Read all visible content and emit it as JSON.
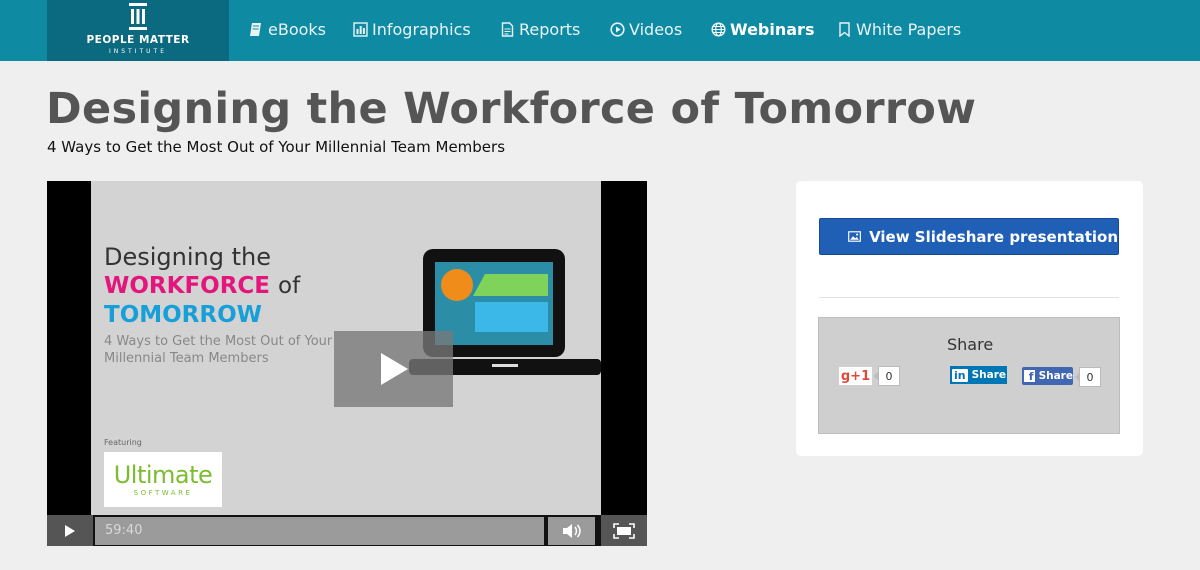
{
  "nav": {
    "logo_line1": "PEOPLE MATTER",
    "logo_line2": "INSTITUTE",
    "items": [
      {
        "label": "eBooks",
        "icon": "book-icon"
      },
      {
        "label": "Infographics",
        "icon": "bar-chart-icon"
      },
      {
        "label": "Reports",
        "icon": "document-icon"
      },
      {
        "label": "Videos",
        "icon": "play-circle-icon"
      },
      {
        "label": "Webinars",
        "icon": "globe-icon",
        "active": true
      },
      {
        "label": "White Papers",
        "icon": "bookmark-icon"
      }
    ]
  },
  "page": {
    "title": "Designing the Workforce of Tomorrow",
    "subtitle": "4 Ways to Get the Most Out of Your Millennial Team Members"
  },
  "video": {
    "slide_line1": "Designing the",
    "slide_workforce": "WORKFORCE",
    "slide_of": "of",
    "slide_tomorrow": "TOMORROW",
    "slide_sub1": "4 Ways to Get the Most Out of Your",
    "slide_sub2": "Millennial Team Members",
    "featuring": "Featuring",
    "sponsor_logo_main": "Ultimate",
    "sponsor_logo_sub": "SOFTWARE",
    "duration": "59:40"
  },
  "sidebar": {
    "slideshare_label": "View Slideshare presentation",
    "share_title": "Share",
    "gplus_label": "g+1",
    "gplus_count": "0",
    "linkedin_label": "Share",
    "facebook_label": "Share",
    "facebook_count": "0"
  },
  "colors": {
    "nav_bg": "#0f8aa3",
    "logo_bg": "#0b6a80",
    "button_blue": "#1f5fb5",
    "slide_pink": "#e4157c",
    "slide_blue": "#17a0d8"
  }
}
